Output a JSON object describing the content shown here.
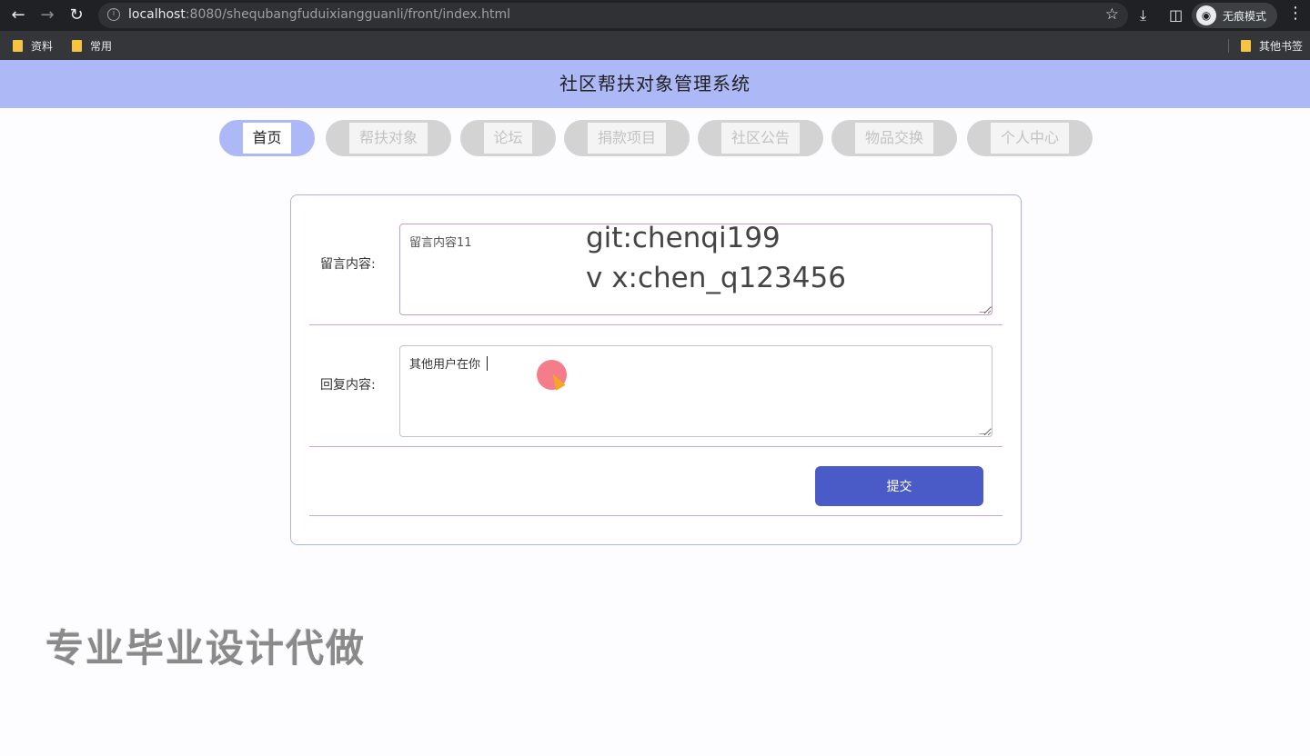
{
  "browser": {
    "url_host": "localhost",
    "url_path": ":8080/shequbangfuduixiangguanli/front/index.html",
    "incognito_label": "无痕模式",
    "bookmarks": [
      "资料",
      "常用"
    ],
    "other_bookmarks": "其他书签"
  },
  "site": {
    "title": "社区帮扶对象管理系统"
  },
  "nav": {
    "items": [
      {
        "label": "首页",
        "active": true
      },
      {
        "label": "帮扶对象",
        "active": false
      },
      {
        "label": "论坛",
        "active": false
      },
      {
        "label": "捐款项目",
        "active": false
      },
      {
        "label": "社区公告",
        "active": false
      },
      {
        "label": "物品交换",
        "active": false
      },
      {
        "label": "个人中心",
        "active": false
      }
    ]
  },
  "form": {
    "message_label": "留言内容:",
    "message_value": "留言内容11",
    "reply_label": "回复内容:",
    "reply_value": "其他用户在你",
    "submit_label": "提交"
  },
  "overlay": {
    "line1": "git:chenqi199",
    "line2": "v x:chen_q123456",
    "watermark": "专业毕业设计代做"
  },
  "colors": {
    "header_bg": "#adb8f7",
    "submit_bg": "#4a5bc7",
    "divider": "#c9a6dc"
  }
}
